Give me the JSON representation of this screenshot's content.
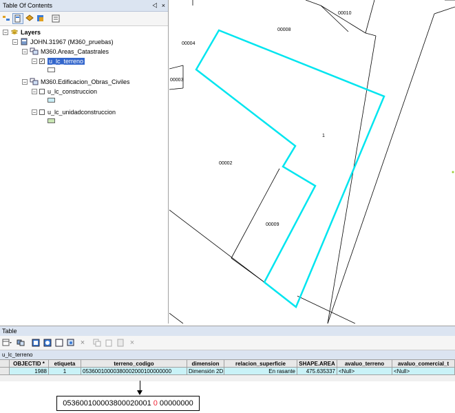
{
  "toc": {
    "title": "Table Of Contents",
    "pin": "⨞",
    "close": "×",
    "root": "Layers",
    "db": "JOHN.31967 (M360_pruebas)",
    "group1": "M360.Areas_Catastrales",
    "layer1": "u_lc_terreno",
    "group2": "M360.Edificacion_Obras_Civiles",
    "layer2": "u_lc_construccion",
    "layer3": "u_lc_unidadconstruccion",
    "swatch_colors": [
      "#ffffff",
      "#c8ecf5",
      "#c9e6b3"
    ]
  },
  "map": {
    "labels": [
      "00010",
      "00008",
      "00004",
      "00003",
      "1",
      "00002",
      "00009"
    ],
    "selection_color": "#00e5ef"
  },
  "table": {
    "title": "Table",
    "name": "u_lc_terreno",
    "headers": [
      "OBJECTID *",
      "etiqueta",
      "terreno_codigo",
      "dimension",
      "relacion_superficie",
      "SHAPE.AREA",
      "avaluo_terreno",
      "avaluo_comercial_t"
    ],
    "row": [
      "1988",
      "1",
      "05360010000380002000100000000",
      "Dimensión 2D",
      "En rasante",
      "475.635337",
      "<Null>",
      "<Null>"
    ]
  },
  "callout": {
    "part1": "053600100003800020001",
    "highlight": "0",
    "part2": "00000000"
  }
}
